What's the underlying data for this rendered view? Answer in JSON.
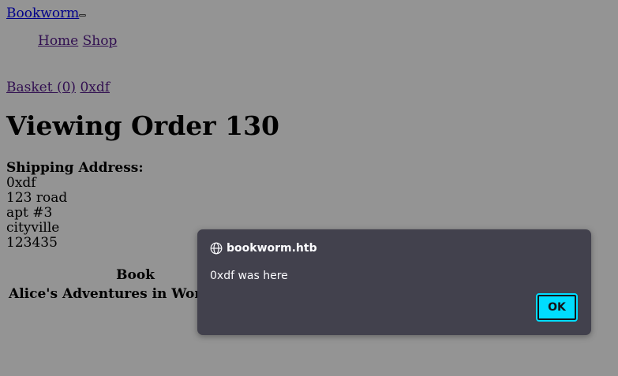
{
  "navbar": {
    "brand": "Bookworm",
    "links": [
      "Home",
      "Shop"
    ],
    "basket": "Basket (0)",
    "user": "0xdf"
  },
  "order": {
    "title": "Viewing Order 130",
    "shipping_label": "Shipping Address:",
    "address_lines": [
      "0xdf",
      "123 road",
      "apt #3",
      "cityville",
      "123435"
    ]
  },
  "table": {
    "header": "Book",
    "rows": [
      "Alice's Adventures in Wonderland"
    ]
  },
  "dialog": {
    "origin": "bookworm.htb",
    "message": "0xdf was here",
    "ok_label": "OK",
    "icon": "globe-icon",
    "accent_color": "#00ddff"
  }
}
